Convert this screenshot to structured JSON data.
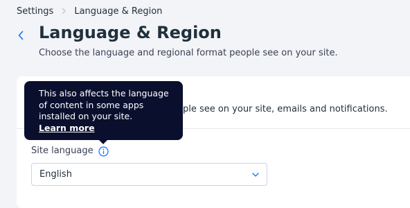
{
  "breadcrumb": {
    "root": "Settings",
    "current": "Language & Region"
  },
  "header": {
    "title": "Language & Region",
    "subtitle": "Choose the language and regional format people see on your site."
  },
  "card": {
    "description": "ople see on your site, emails and notifications."
  },
  "site_language": {
    "label": "Site language",
    "selected": "English",
    "tooltip": {
      "lines": [
        "This also affects the language",
        "of content in some apps",
        "installed on your site."
      ],
      "link": "Learn more"
    }
  },
  "icons": {
    "back": "chevron-left-icon",
    "breadcrumb_separator": "chevron-right-icon",
    "info": "info-icon",
    "dropdown": "chevron-down-icon"
  },
  "colors": {
    "accent": "#116dff",
    "text": "#20303c",
    "tooltip_bg": "#0a0f2e",
    "page_bg": "#f2f4f7"
  }
}
